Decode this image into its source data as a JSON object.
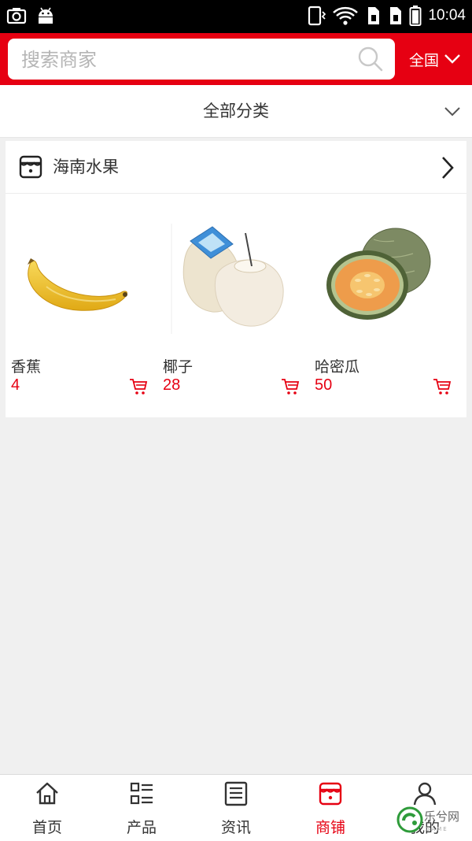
{
  "status_bar": {
    "time": "10:04",
    "icons": [
      "screenshot-icon",
      "android-icon",
      "phone-vibrate-icon",
      "wifi-icon",
      "sim1-icon",
      "sim2-icon",
      "battery-icon"
    ]
  },
  "header": {
    "search_placeholder": "搜索商家",
    "region_label": "全国",
    "accent_color": "#e60012"
  },
  "category_bar": {
    "label": "全部分类"
  },
  "shop": {
    "name": "海南水果",
    "products": [
      {
        "name": "香蕉",
        "price": "4",
        "image": "banana"
      },
      {
        "name": "椰子",
        "price": "28",
        "image": "coconut"
      },
      {
        "name": "哈密瓜",
        "price": "50",
        "image": "melon"
      }
    ]
  },
  "tab_bar": {
    "tabs": [
      {
        "label": "首页",
        "icon": "home-icon"
      },
      {
        "label": "产品",
        "icon": "list-icon"
      },
      {
        "label": "资讯",
        "icon": "news-icon"
      },
      {
        "label": "商铺",
        "icon": "shop-icon",
        "active": true
      },
      {
        "label": "我的",
        "icon": "user-icon"
      }
    ]
  },
  "watermark": {
    "text": "乐兮网",
    "subtext": "GAME"
  }
}
